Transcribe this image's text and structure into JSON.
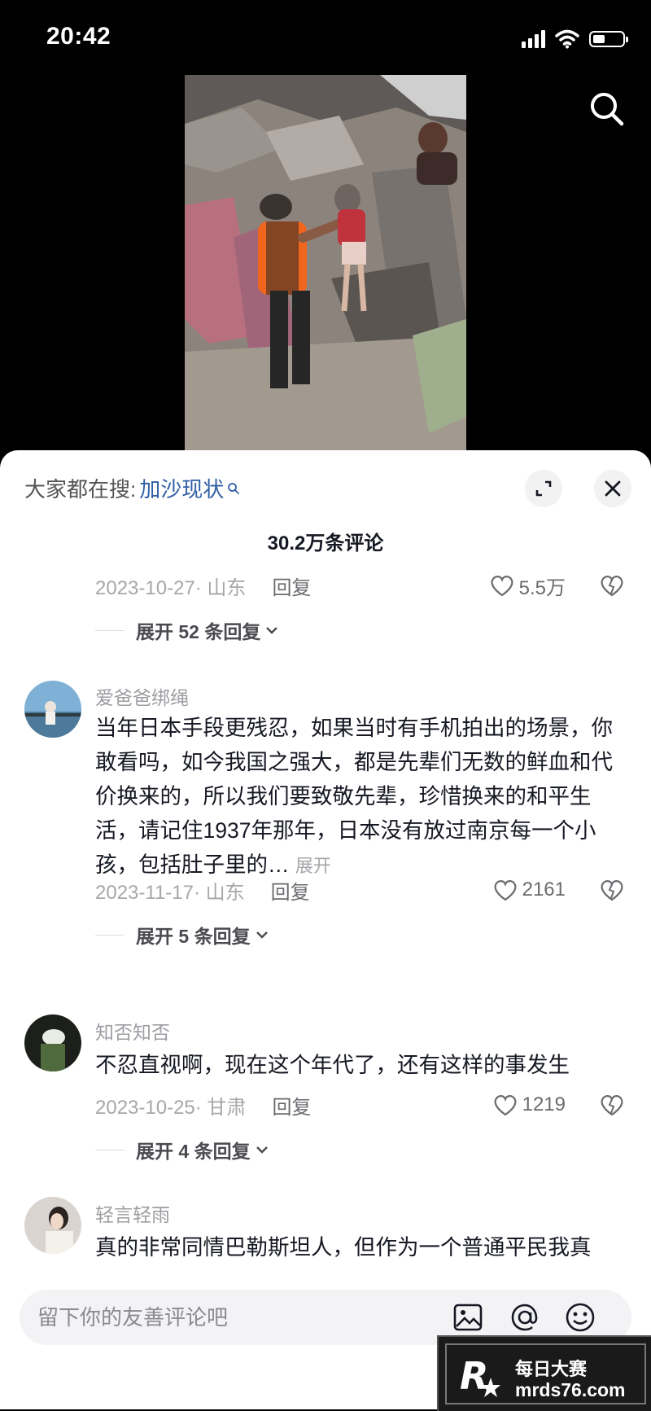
{
  "status_bar": {
    "time": "20:42",
    "battery_level": 0.4
  },
  "search": {
    "icon": "search-icon"
  },
  "panel": {
    "trending_prefix": "大家都在搜:",
    "trending_keyword": "加沙现状",
    "comment_count": "30.2万条评论"
  },
  "comments": [
    {
      "date_location": "2023-10-27· 山东",
      "reply": "回复",
      "likes": "5.5万",
      "expand": "展开 52 条回复"
    },
    {
      "username": "爱爸爸绑绳",
      "text": "当年日本手段更残忍，如果当时有手机拍出的场景，你敢看吗，如今我国之强大，都是先辈们无数的鲜血和代价换来的，所以我们要致敬先辈，珍惜换来的和平生活，请记住1937年那年，日本没有放过南京每一个小孩，包括肚子里的…",
      "expand_link": "展开",
      "date_location": "2023-11-17· 山东",
      "reply": "回复",
      "likes": "2161",
      "expand": "展开 5 条回复"
    },
    {
      "username": "知否知否",
      "text": "不忍直视啊，现在这个年代了，还有这样的事发生",
      "date_location": "2023-10-25· 甘肃",
      "reply": "回复",
      "likes": "1219",
      "expand": "展开 4 条回复"
    },
    {
      "username": "轻言轻雨",
      "text": "真的非常同情巴勒斯坦人，但作为一个普通平民我真"
    }
  ],
  "input": {
    "placeholder": "留下你的友善评论吧"
  },
  "watermark": {
    "line1": "每日大赛",
    "line2": "mrds76.com"
  }
}
